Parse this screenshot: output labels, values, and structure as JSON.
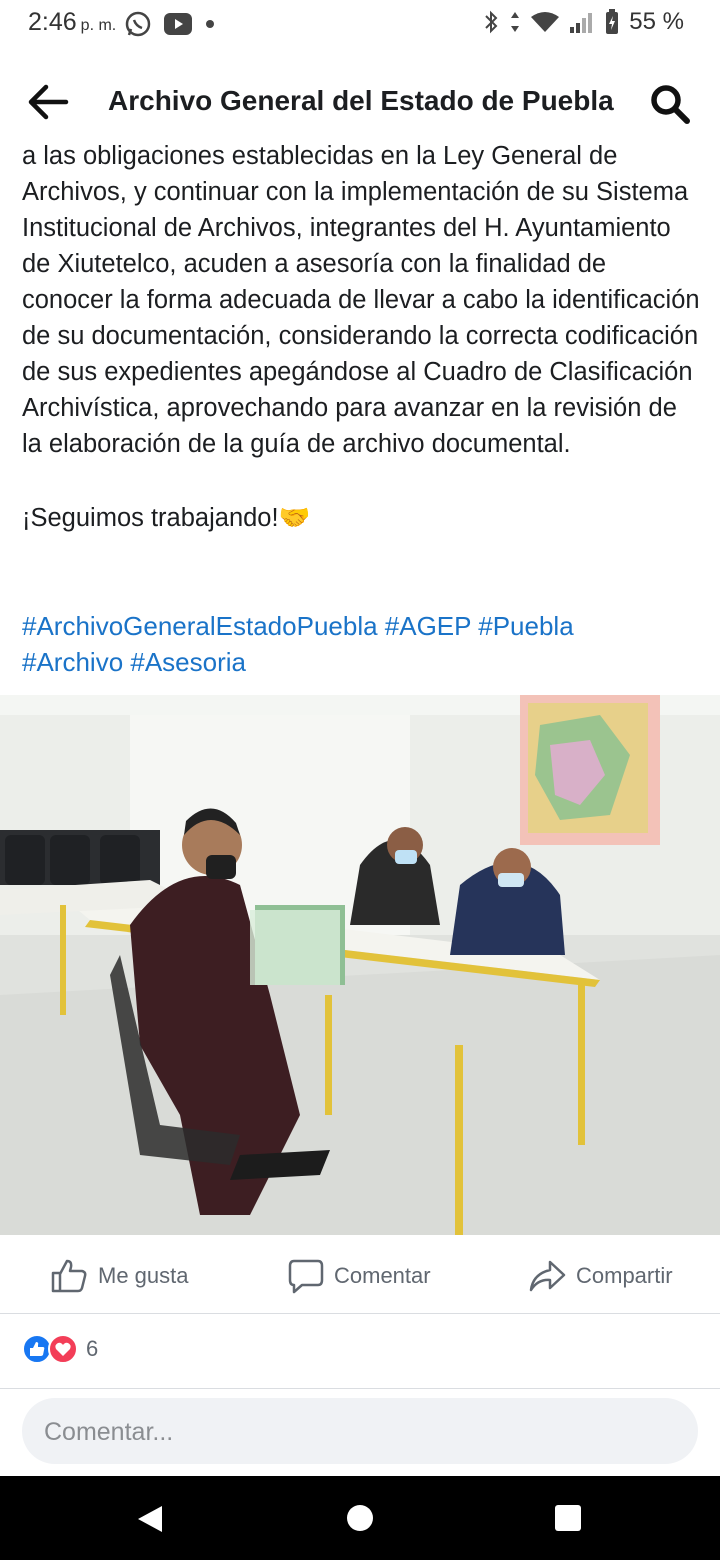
{
  "status_bar": {
    "time": "2:46",
    "ampm": "p. m.",
    "battery": "55 %"
  },
  "header": {
    "title": "Archivo General del Estado de Puebla"
  },
  "post": {
    "body_text": "a las obligaciones establecidas en la Ley General de Archivos, y continuar con la implementación de su Sistema Institucional de Archivos, integrantes del H. Ayuntamiento de Xiutetelco, acuden a asesoría con la finalidad de conocer la forma adecuada de llevar a cabo la identificación de su documentación, considerando la correcta codificación de sus expedientes apegándose al Cuadro de Clasificación Archivística, aprovechando para avanzar en la revisión de la elaboración de la guía de archivo documental.",
    "closing_text": "¡Seguimos trabajando!🤝",
    "hashtags_line1": "#ArchivoGeneralEstadoPuebla #AGEP #Puebla",
    "hashtags_line2": "#Archivo #Asesoria"
  },
  "actions": {
    "like": "Me gusta",
    "comment": "Comentar",
    "share": "Compartir"
  },
  "reactions": {
    "count": "6"
  },
  "comment_box": {
    "placeholder": "Comentar..."
  },
  "colors": {
    "hashtag": "#1a73c8",
    "like_blue": "#1877f2",
    "love_red": "#f33e58"
  }
}
